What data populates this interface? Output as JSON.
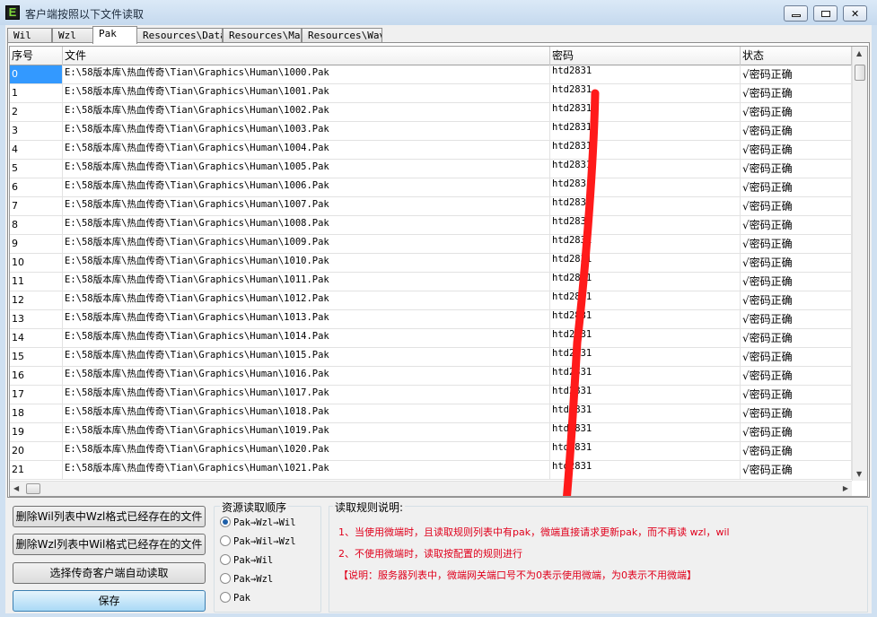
{
  "window": {
    "title": "客户端按照以下文件读取",
    "app_icon_letter": "E",
    "close_glyph": "✕"
  },
  "tabs": [
    {
      "label": "Wil"
    },
    {
      "label": "Wzl"
    },
    {
      "label": "Pak",
      "active": true
    },
    {
      "label": "Resources\\Data"
    },
    {
      "label": "Resources\\Map"
    },
    {
      "label": "Resources\\Wav"
    }
  ],
  "grid": {
    "columns": {
      "index": "序号",
      "file": "文件",
      "password": "密码",
      "status": "状态"
    },
    "rows": [
      {
        "index": "0",
        "file": "E:\\58版本库\\热血传奇\\Tian\\Graphics\\Human\\1000.Pak",
        "password": "htd2831",
        "status": "√密码正确"
      },
      {
        "index": "1",
        "file": "E:\\58版本库\\热血传奇\\Tian\\Graphics\\Human\\1001.Pak",
        "password": "htd2831",
        "status": "√密码正确"
      },
      {
        "index": "2",
        "file": "E:\\58版本库\\热血传奇\\Tian\\Graphics\\Human\\1002.Pak",
        "password": "htd2831",
        "status": "√密码正确"
      },
      {
        "index": "3",
        "file": "E:\\58版本库\\热血传奇\\Tian\\Graphics\\Human\\1003.Pak",
        "password": "htd2831",
        "status": "√密码正确"
      },
      {
        "index": "4",
        "file": "E:\\58版本库\\热血传奇\\Tian\\Graphics\\Human\\1004.Pak",
        "password": "htd2831",
        "status": "√密码正确"
      },
      {
        "index": "5",
        "file": "E:\\58版本库\\热血传奇\\Tian\\Graphics\\Human\\1005.Pak",
        "password": "htd2831",
        "status": "√密码正确"
      },
      {
        "index": "6",
        "file": "E:\\58版本库\\热血传奇\\Tian\\Graphics\\Human\\1006.Pak",
        "password": "htd2831",
        "status": "√密码正确"
      },
      {
        "index": "7",
        "file": "E:\\58版本库\\热血传奇\\Tian\\Graphics\\Human\\1007.Pak",
        "password": "htd2831",
        "status": "√密码正确"
      },
      {
        "index": "8",
        "file": "E:\\58版本库\\热血传奇\\Tian\\Graphics\\Human\\1008.Pak",
        "password": "htd2831",
        "status": "√密码正确"
      },
      {
        "index": "9",
        "file": "E:\\58版本库\\热血传奇\\Tian\\Graphics\\Human\\1009.Pak",
        "password": "htd2831",
        "status": "√密码正确"
      },
      {
        "index": "10",
        "file": "E:\\58版本库\\热血传奇\\Tian\\Graphics\\Human\\1010.Pak",
        "password": "htd2831",
        "status": "√密码正确"
      },
      {
        "index": "11",
        "file": "E:\\58版本库\\热血传奇\\Tian\\Graphics\\Human\\1011.Pak",
        "password": "htd2831",
        "status": "√密码正确"
      },
      {
        "index": "12",
        "file": "E:\\58版本库\\热血传奇\\Tian\\Graphics\\Human\\1012.Pak",
        "password": "htd2831",
        "status": "√密码正确"
      },
      {
        "index": "13",
        "file": "E:\\58版本库\\热血传奇\\Tian\\Graphics\\Human\\1013.Pak",
        "password": "htd2831",
        "status": "√密码正确"
      },
      {
        "index": "14",
        "file": "E:\\58版本库\\热血传奇\\Tian\\Graphics\\Human\\1014.Pak",
        "password": "htd2831",
        "status": "√密码正确"
      },
      {
        "index": "15",
        "file": "E:\\58版本库\\热血传奇\\Tian\\Graphics\\Human\\1015.Pak",
        "password": "htd2831",
        "status": "√密码正确"
      },
      {
        "index": "16",
        "file": "E:\\58版本库\\热血传奇\\Tian\\Graphics\\Human\\1016.Pak",
        "password": "htd2831",
        "status": "√密码正确"
      },
      {
        "index": "17",
        "file": "E:\\58版本库\\热血传奇\\Tian\\Graphics\\Human\\1017.Pak",
        "password": "htd2831",
        "status": "√密码正确"
      },
      {
        "index": "18",
        "file": "E:\\58版本库\\热血传奇\\Tian\\Graphics\\Human\\1018.Pak",
        "password": "htd2831",
        "status": "√密码正确"
      },
      {
        "index": "19",
        "file": "E:\\58版本库\\热血传奇\\Tian\\Graphics\\Human\\1019.Pak",
        "password": "htd2831",
        "status": "√密码正确"
      },
      {
        "index": "20",
        "file": "E:\\58版本库\\热血传奇\\Tian\\Graphics\\Human\\1020.Pak",
        "password": "htd2831",
        "status": "√密码正确"
      },
      {
        "index": "21",
        "file": "E:\\58版本库\\热血传奇\\Tian\\Graphics\\Human\\1021.Pak",
        "password": "htd2831",
        "status": "√密码正确"
      }
    ],
    "scroll_arrows": {
      "up": "▲",
      "down": "▼",
      "left": "◀",
      "right": "▶"
    }
  },
  "buttons": {
    "delete_wil": "删除Wil列表中Wzl格式已经存在的文件",
    "delete_wzl": "删除Wzl列表中Wil格式已经存在的文件",
    "auto_read": "选择传奇客户端自动读取",
    "save": "保存"
  },
  "read_order": {
    "legend": "资源读取顺序",
    "options": [
      {
        "label": "Pak→Wzl→Wil",
        "checked": true
      },
      {
        "label": "Pak→Wil→Wzl",
        "checked": false
      },
      {
        "label": "Pak→Wil",
        "checked": false
      },
      {
        "label": "Pak→Wzl",
        "checked": false
      },
      {
        "label": "Pak",
        "checked": false
      }
    ]
  },
  "rules": {
    "legend": "读取规则说明:",
    "lines": [
      "1、当使用微端时，且读取规则列表中有pak，微端直接请求更新pak，而不再读 wzl，wil",
      "2、不使用微端时，读取按配置的规则进行",
      "【说明：服务器列表中，微端网关端口号不为0表示使用微端，为0表示不用微端】"
    ]
  },
  "colors": {
    "selection": "#3399ff",
    "rule_text": "#e0001c",
    "annotation_stroke": "#ff1a1a"
  }
}
